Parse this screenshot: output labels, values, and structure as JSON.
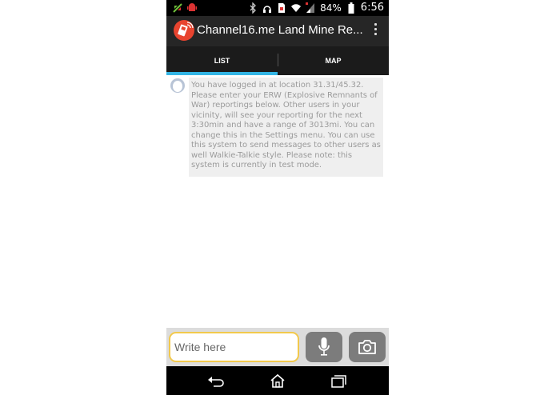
{
  "status_bar": {
    "battery": "84%",
    "time": "6:56",
    "icons": [
      "sync-icon",
      "android-icon",
      "bluetooth-icon",
      "headset-icon",
      "sim-icon",
      "wifi-icon",
      "signal-icon",
      "battery-icon"
    ]
  },
  "action_bar": {
    "title": "Channel16.me Land Mine Re...",
    "logo_icon": "walkie-talkie-icon",
    "menu_icon": "overflow-menu-icon"
  },
  "tabs": [
    {
      "label": "LIST",
      "active": true
    },
    {
      "label": "MAP",
      "active": false
    }
  ],
  "messages": [
    {
      "avatar_icon": "user-avatar-icon",
      "text": "You have logged in at location 31.31/45.32. Please enter your ERW (Explosive Remnants of War) reportings below. Other users in your vicinity, will see your reporting for the next 3:30min and have a range of 3013mi. You can change this in the Settings menu. You can use this system to send messages to other users as well Walkie-Talkie style. Please note: this system is currently in test mode."
    }
  ],
  "composer": {
    "placeholder": "Write here",
    "mic_icon": "microphone-icon",
    "camera_icon": "camera-icon"
  },
  "nav_bar": {
    "icons": [
      "back-icon",
      "home-icon",
      "recent-apps-icon"
    ]
  },
  "colors": {
    "accent": "#33b5e5",
    "action_bar": "#262626",
    "logo": "#e8442f",
    "input_border": "#f2c94c"
  }
}
